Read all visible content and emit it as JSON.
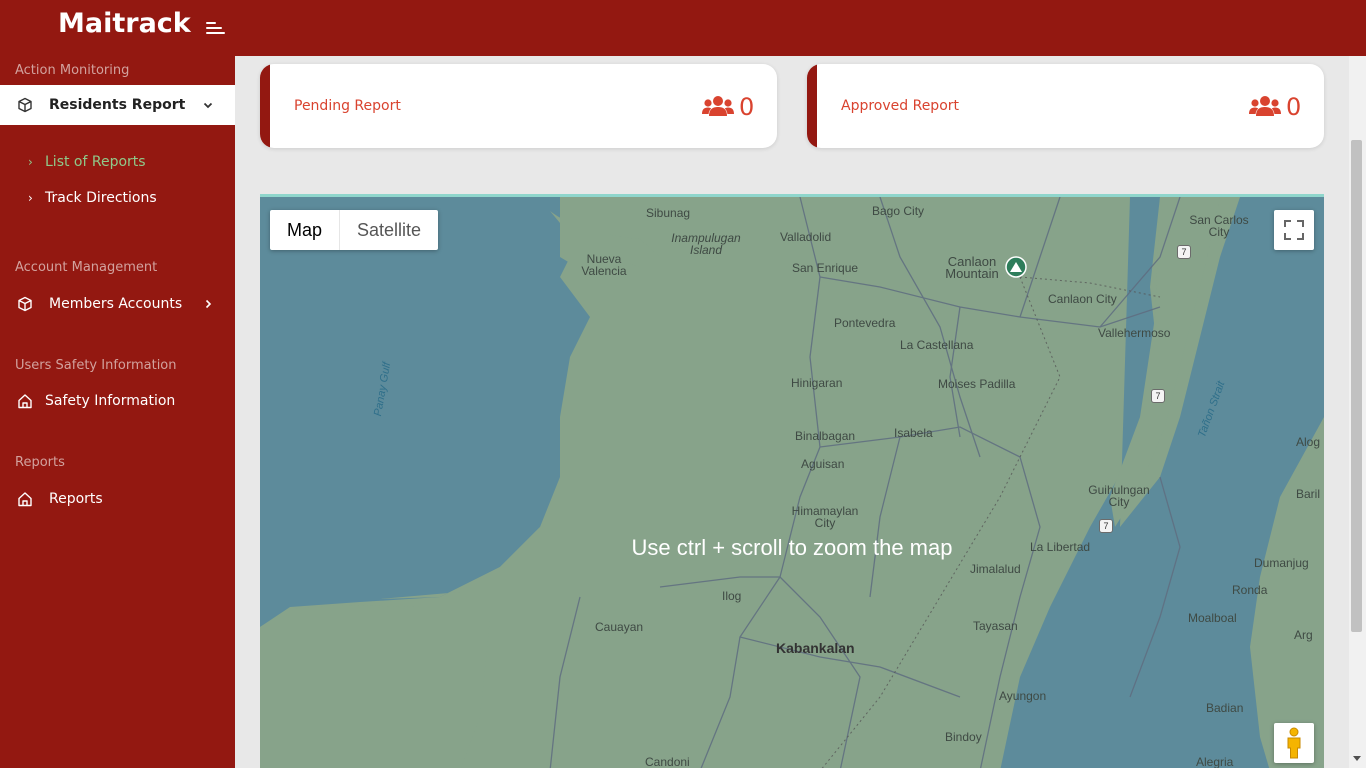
{
  "app": {
    "title": "Maitrack"
  },
  "sidebar": {
    "sections": [
      {
        "title": "Action Monitoring"
      },
      {
        "title": "Account Management"
      },
      {
        "title": "Users Safety Information"
      },
      {
        "title": "Reports"
      }
    ],
    "items": [
      {
        "label": "Residents Report",
        "icon": "cube-icon",
        "expanded": true
      },
      {
        "label": "Members Accounts",
        "icon": "cube-icon"
      },
      {
        "label": "Safety Information",
        "icon": "home-icon"
      },
      {
        "label": "Reports",
        "icon": "home-icon"
      }
    ],
    "sub_items": [
      {
        "label": "List of Reports",
        "active": true
      },
      {
        "label": "Track Directions"
      }
    ]
  },
  "cards": [
    {
      "label": "Pending Report",
      "count": "0",
      "icon": "users-icon"
    },
    {
      "label": "Approved Report",
      "count": "0",
      "icon": "users-icon"
    }
  ],
  "map": {
    "type_controls": {
      "map": "Map",
      "satellite": "Satellite",
      "selected": "Map"
    },
    "zoom_hint": "Use ctrl + scroll to zoom the map",
    "places": [
      "Sibunag",
      "Inampulugan Island",
      "Nueva Valencia",
      "Valladolid",
      "Bago City",
      "San Carlos City",
      "San Enrique",
      "Canlaon Mountain",
      "Canlaon City",
      "Pontevedra",
      "La Castellana",
      "Vallehermoso",
      "Hinigaran",
      "Moises Padilla",
      "Binalbagan",
      "Isabela",
      "Alog",
      "Aguisan",
      "Guihulngan City",
      "Baril",
      "Himamaylan City",
      "La Libertad",
      "Jimalalud",
      "Dumanjug",
      "Ilog",
      "Ronda",
      "Cauayan",
      "Moalboal",
      "Tayasan",
      "Arg",
      "Kabankalan",
      "Ayungon",
      "Badian",
      "Bindoy",
      "Candoni",
      "Alegria",
      "Da"
    ],
    "water": [
      "Panay Gulf",
      "Tañon Strait"
    ],
    "road_shields": [
      "7",
      "7",
      "7"
    ],
    "colors": {
      "land": "#87a38a",
      "water": "#5d8b9b",
      "roads": "#5f6d80"
    }
  },
  "colors": {
    "primary": "#931811",
    "accent": "#d9432f",
    "active_sub": "#8fc98a"
  }
}
